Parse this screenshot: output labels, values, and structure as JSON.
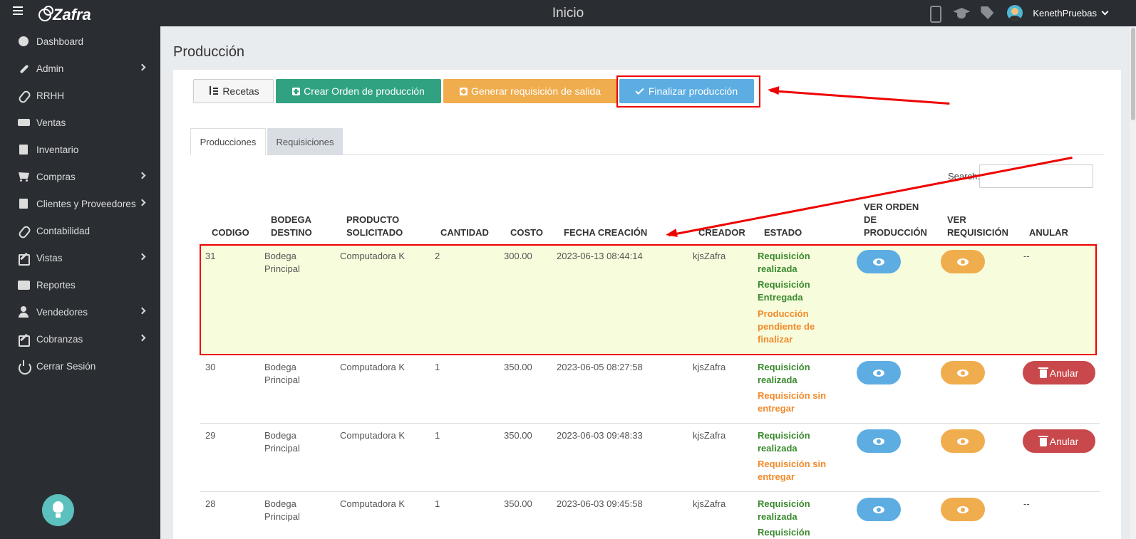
{
  "topbar": {
    "brand": "Zafra",
    "title": "Inicio",
    "username": "KenethPruebas"
  },
  "sidebar": {
    "items": [
      {
        "label": "Dashboard"
      },
      {
        "label": "Admin"
      },
      {
        "label": "RRHH"
      },
      {
        "label": "Ventas"
      },
      {
        "label": "Inventario"
      },
      {
        "label": "Compras"
      },
      {
        "label": "Clientes y Proveedores"
      },
      {
        "label": "Contabilidad"
      },
      {
        "label": "Vistas"
      },
      {
        "label": "Reportes"
      },
      {
        "label": "Vendedores"
      },
      {
        "label": "Cobranzas"
      },
      {
        "label": "Cerrar Sesión"
      }
    ]
  },
  "page": {
    "title": "Producción"
  },
  "toolbar": {
    "recetas": "Recetas",
    "crear": "Crear Orden de producción",
    "generar": "Generar requisición de salida",
    "finalizar": "Finalizar producción"
  },
  "tabs": [
    "Producciones",
    "Requisiciones"
  ],
  "search": {
    "label": "Search:"
  },
  "table": {
    "headers": {
      "codigo": "CODIGO",
      "bodega_1": "BODEGA",
      "bodega_2": "DESTINO",
      "producto_1": "PRODUCTO",
      "producto_2": "SOLICITADO",
      "cantidad": "CANTIDAD",
      "costo": "COSTO",
      "fecha": "FECHA CREACIÓN",
      "creador": "CREADOR",
      "estado": "ESTADO",
      "ver_orden_1": "VER ORDEN",
      "ver_orden_2": "DE",
      "ver_orden_3": "PRODUCCIÓN",
      "ver_req_1": "VER",
      "ver_req_2": "REQUISICIÓN",
      "anular": "ANULAR"
    },
    "anular_label": "Anular",
    "rows": [
      {
        "codigo": "31",
        "bodega_1": "Bodega",
        "bodega_2": "Principal",
        "producto": "Computadora K",
        "cantidad": "2",
        "costo": "300.00",
        "fecha": "2023-06-13 08:44:14",
        "creador": "kjsZafra",
        "estado": [
          {
            "l1": "Requisición",
            "l2": "realizada",
            "l3": ""
          },
          {
            "l1": "Requisición",
            "l2": "Entregada",
            "l3": ""
          },
          {
            "l1": "Producción",
            "l2": "pendiente de",
            "l3": "finalizar"
          }
        ],
        "anular": "--"
      },
      {
        "codigo": "30",
        "bodega_1": "Bodega",
        "bodega_2": "Principal",
        "producto": "Computadora K",
        "cantidad": "1",
        "costo": "350.00",
        "fecha": "2023-06-05 08:27:58",
        "creador": "kjsZafra",
        "estado": [
          {
            "l1": "Requisición",
            "l2": "realizada"
          },
          {
            "l1": "Requisición sin",
            "l2": "entregar"
          }
        ],
        "anular": ""
      },
      {
        "codigo": "29",
        "bodega_1": "Bodega",
        "bodega_2": "Principal",
        "producto": "Computadora K",
        "cantidad": "1",
        "costo": "350.00",
        "fecha": "2023-06-03 09:48:33",
        "creador": "kjsZafra",
        "estado": [
          {
            "l1": "Requisición",
            "l2": "realizada"
          },
          {
            "l1": "Requisición sin",
            "l2": "entregar"
          }
        ],
        "anular": ""
      },
      {
        "codigo": "28",
        "bodega_1": "Bodega",
        "bodega_2": "Principal",
        "producto": "Computadora K",
        "cantidad": "1",
        "costo": "350.00",
        "fecha": "2023-06-03 09:45:58",
        "creador": "kjsZafra",
        "estado": [
          {
            "l1": "Requisición",
            "l2": "realizada"
          },
          {
            "l1": "Requisición"
          }
        ],
        "anular": "--"
      }
    ]
  },
  "colors": {
    "green": "#30a282",
    "orange": "#f0ad4e",
    "blue": "#5dade2",
    "red": "#c9484c",
    "sidebar": "#2a2e33"
  }
}
